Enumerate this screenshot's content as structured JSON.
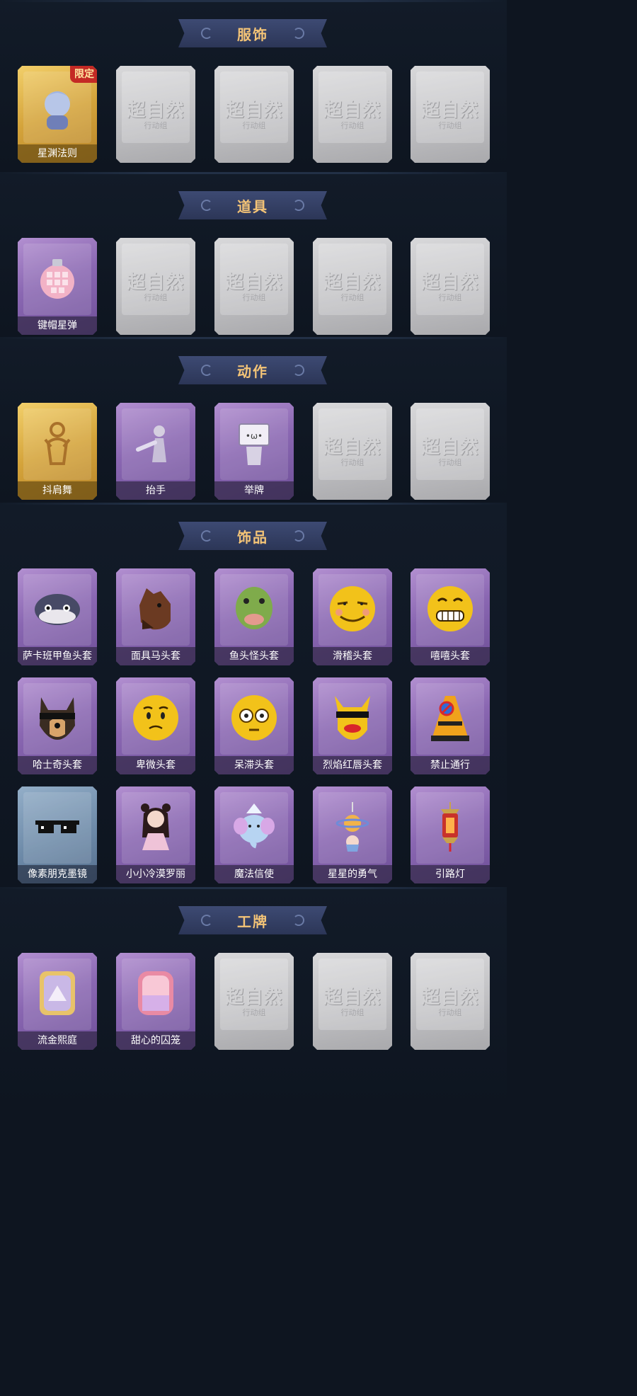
{
  "sections": [
    {
      "title": "服饰",
      "items": [
        {
          "label": "星渊法则",
          "style": "gold",
          "icon": "character-portrait-icon",
          "tag": "限定"
        },
        {
          "label": "",
          "style": "empty",
          "icon": "placeholder-icon"
        },
        {
          "label": "",
          "style": "empty",
          "icon": "placeholder-icon"
        },
        {
          "label": "",
          "style": "empty",
          "icon": "placeholder-icon"
        },
        {
          "label": "",
          "style": "empty",
          "icon": "placeholder-icon"
        }
      ]
    },
    {
      "title": "道具",
      "items": [
        {
          "label": "键帽星弹",
          "style": "purple",
          "icon": "grenade-icon"
        },
        {
          "label": "",
          "style": "empty",
          "icon": "placeholder-icon"
        },
        {
          "label": "",
          "style": "empty",
          "icon": "placeholder-icon"
        },
        {
          "label": "",
          "style": "empty",
          "icon": "placeholder-icon"
        },
        {
          "label": "",
          "style": "empty",
          "icon": "placeholder-icon"
        }
      ]
    },
    {
      "title": "动作",
      "items": [
        {
          "label": "抖肩舞",
          "style": "gold",
          "icon": "dance-figure-icon"
        },
        {
          "label": "抬手",
          "style": "purple",
          "icon": "raise-hand-icon"
        },
        {
          "label": "举牌",
          "style": "purple",
          "icon": "hold-sign-icon"
        },
        {
          "label": "",
          "style": "empty",
          "icon": "placeholder-icon"
        },
        {
          "label": "",
          "style": "empty",
          "icon": "placeholder-icon"
        }
      ]
    },
    {
      "title": "饰品",
      "items": [
        {
          "label": "萨卡班甲鱼头套",
          "style": "purple",
          "icon": "fish-head-icon"
        },
        {
          "label": "面具马头套",
          "style": "purple",
          "icon": "horse-head-icon"
        },
        {
          "label": "鱼头怪头套",
          "style": "purple",
          "icon": "green-fish-head-icon"
        },
        {
          "label": "滑稽头套",
          "style": "purple",
          "icon": "funny-face-icon"
        },
        {
          "label": "嘻嘻头套",
          "style": "purple",
          "icon": "grin-face-icon"
        },
        {
          "label": "哈士奇头套",
          "style": "purple",
          "icon": "husky-head-icon"
        },
        {
          "label": "卑微头套",
          "style": "purple",
          "icon": "humble-face-icon"
        },
        {
          "label": "呆滞头套",
          "style": "purple",
          "icon": "dazed-face-icon"
        },
        {
          "label": "烈焰红唇头套",
          "style": "purple",
          "icon": "red-lips-head-icon"
        },
        {
          "label": "禁止通行",
          "style": "purple",
          "icon": "traffic-cone-icon"
        },
        {
          "label": "像素朋克墨镜",
          "style": "blue",
          "icon": "pixel-sunglasses-icon"
        },
        {
          "label": "小小冷漠罗丽",
          "style": "purple",
          "icon": "doll-icon"
        },
        {
          "label": "魔法信使",
          "style": "purple",
          "icon": "elephant-icon"
        },
        {
          "label": "星星的勇气",
          "style": "purple",
          "icon": "planet-charm-icon"
        },
        {
          "label": "引路灯",
          "style": "purple",
          "icon": "lantern-icon"
        }
      ]
    },
    {
      "title": "工牌",
      "items": [
        {
          "label": "流金熙庭",
          "style": "purple",
          "icon": "gold-frame-card-icon"
        },
        {
          "label": "甜心的囚笼",
          "style": "purple",
          "icon": "pink-mirror-card-icon"
        },
        {
          "label": "",
          "style": "empty",
          "icon": "placeholder-icon"
        },
        {
          "label": "",
          "style": "empty",
          "icon": "placeholder-icon"
        },
        {
          "label": "",
          "style": "empty",
          "icon": "placeholder-icon"
        }
      ]
    }
  ],
  "placeholder": {
    "watermark": "超自然",
    "subtitle": "行动组"
  },
  "colors": {
    "background": "#0e1520",
    "banner": "#353f64",
    "banner_text": "#f4c477",
    "purple_card": "#8a67b2",
    "gold_card": "#d4a33a",
    "empty_card": "#bfbfc2",
    "limited_tag": "#c42a25"
  }
}
